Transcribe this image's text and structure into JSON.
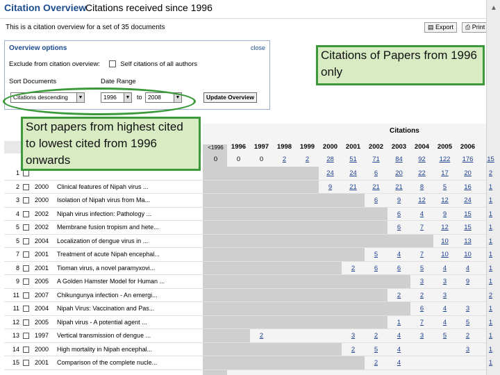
{
  "header": {
    "brand": "Citation Overview",
    "subtitle": "Citations received since 1996"
  },
  "description": "This is a citation overview for a set of 35 documents",
  "toolbar": {
    "export": "Export",
    "print": "Print"
  },
  "options": {
    "title": "Overview options",
    "close": "close",
    "exclude_label": "Exclude from citation overview:",
    "exclude_option": "Self citations of all authors",
    "sort_label": "Sort Documents",
    "date_label": "Date Range",
    "sort_value": "Citations descending",
    "from_year": "1996",
    "to_label": "to",
    "to_year": "2008",
    "update": "Update Overview"
  },
  "callouts": {
    "top_right": "Citations of Papers from 1996 only",
    "left": "Sort papers from highest cited to lowest cited from 1996 onwards"
  },
  "table": {
    "citations_label": "Citations",
    "pre_label": "<1996",
    "years": [
      "1996",
      "1997",
      "1998",
      "1999",
      "2000",
      "2001",
      "2002",
      "2003",
      "2004",
      "2005",
      "2006"
    ],
    "totals": [
      "0",
      "0",
      "0",
      "2",
      "2",
      "28",
      "51",
      "71",
      "84",
      "92",
      "122",
      "176",
      "15"
    ],
    "rows": [
      {
        "num": "1",
        "year": "",
        "title": "",
        "cells": [
          "",
          "",
          "",
          "",
          "",
          "24",
          "24",
          "6",
          "20",
          "22",
          "17",
          "20",
          "2"
        ]
      },
      {
        "num": "2",
        "year": "2000",
        "title": "Clinical features of Nipah virus ...",
        "cells": [
          "",
          "",
          "",
          "",
          "",
          "9",
          "21",
          "21",
          "21",
          "8",
          "5",
          "16",
          "1"
        ]
      },
      {
        "num": "3",
        "year": "2000",
        "title": "Isolation of Nipah virus from Ma...",
        "cells": [
          "",
          "",
          "",
          "",
          "",
          "",
          "",
          "6",
          "9",
          "12",
          "12",
          "24",
          "1"
        ]
      },
      {
        "num": "4",
        "year": "2002",
        "title": "Nipah virus infection: Pathology ...",
        "cells": [
          "",
          "",
          "",
          "",
          "",
          "",
          "",
          "",
          "6",
          "4",
          "9",
          "15",
          "1"
        ]
      },
      {
        "num": "5",
        "year": "2002",
        "title": "Membrane fusion tropism and hete...",
        "cells": [
          "",
          "",
          "",
          "",
          "",
          "",
          "",
          "",
          "6",
          "7",
          "12",
          "15",
          "1"
        ]
      },
      {
        "num": "5",
        "year": "2004",
        "title": "Localization of dengue virus in ...",
        "cells": [
          "",
          "",
          "",
          "",
          "",
          "",
          "",
          "",
          "",
          "",
          "10",
          "13",
          "1"
        ]
      },
      {
        "num": "7",
        "year": "2001",
        "title": "Treatment of acute Nipah encephal...",
        "cells": [
          "",
          "",
          "",
          "",
          "",
          "",
          "",
          "5",
          "4",
          "7",
          "10",
          "10",
          "1"
        ]
      },
      {
        "num": "8",
        "year": "2001",
        "title": "Tioman virus, a novel paramyxovi...",
        "cells": [
          "",
          "",
          "",
          "",
          "",
          "",
          "2",
          "6",
          "6",
          "5",
          "4",
          "4",
          "1"
        ]
      },
      {
        "num": "9",
        "year": "2005",
        "title": "A Golden Hamster Model for Human ...",
        "cells": [
          "",
          "",
          "",
          "",
          "",
          "",
          "",
          "",
          "",
          "3",
          "3",
          "9",
          "1"
        ]
      },
      {
        "num": "11",
        "year": "2007",
        "title": "Chikungunya infection - An emergi...",
        "cells": [
          "",
          "",
          "",
          "",
          "",
          "",
          "",
          "",
          "2",
          "2",
          "3",
          "",
          "2"
        ]
      },
      {
        "num": "11",
        "year": "2004",
        "title": "Nipah Virus: Vaccination and Pas...",
        "cells": [
          "",
          "",
          "",
          "",
          "",
          "",
          "",
          "",
          "",
          "6",
          "4",
          "3",
          "1"
        ]
      },
      {
        "num": "12",
        "year": "2005",
        "title": "Nipah virus - A potential agent ...",
        "cells": [
          "",
          "",
          "",
          "",
          "",
          "",
          "",
          "",
          "1",
          "7",
          "4",
          "5",
          "1"
        ]
      },
      {
        "num": "13",
        "year": "1997",
        "title": "Vertical transmission of dengue ...",
        "cells": [
          "",
          "",
          "2",
          "",
          "",
          "",
          "3",
          "2",
          "4",
          "3",
          "5",
          "2",
          "1"
        ]
      },
      {
        "num": "14",
        "year": "2000",
        "title": "High mortality in Nipah encephal...",
        "cells": [
          "",
          "",
          "",
          "",
          "",
          "",
          "2",
          "5",
          "4",
          "",
          "",
          "3",
          "1"
        ]
      },
      {
        "num": "15",
        "year": "2001",
        "title": "Comparison of the complete nucle...",
        "cells": [
          "",
          "",
          "",
          "",
          "",
          "",
          "",
          "2",
          "4",
          "",
          "",
          "",
          "1"
        ]
      }
    ]
  }
}
